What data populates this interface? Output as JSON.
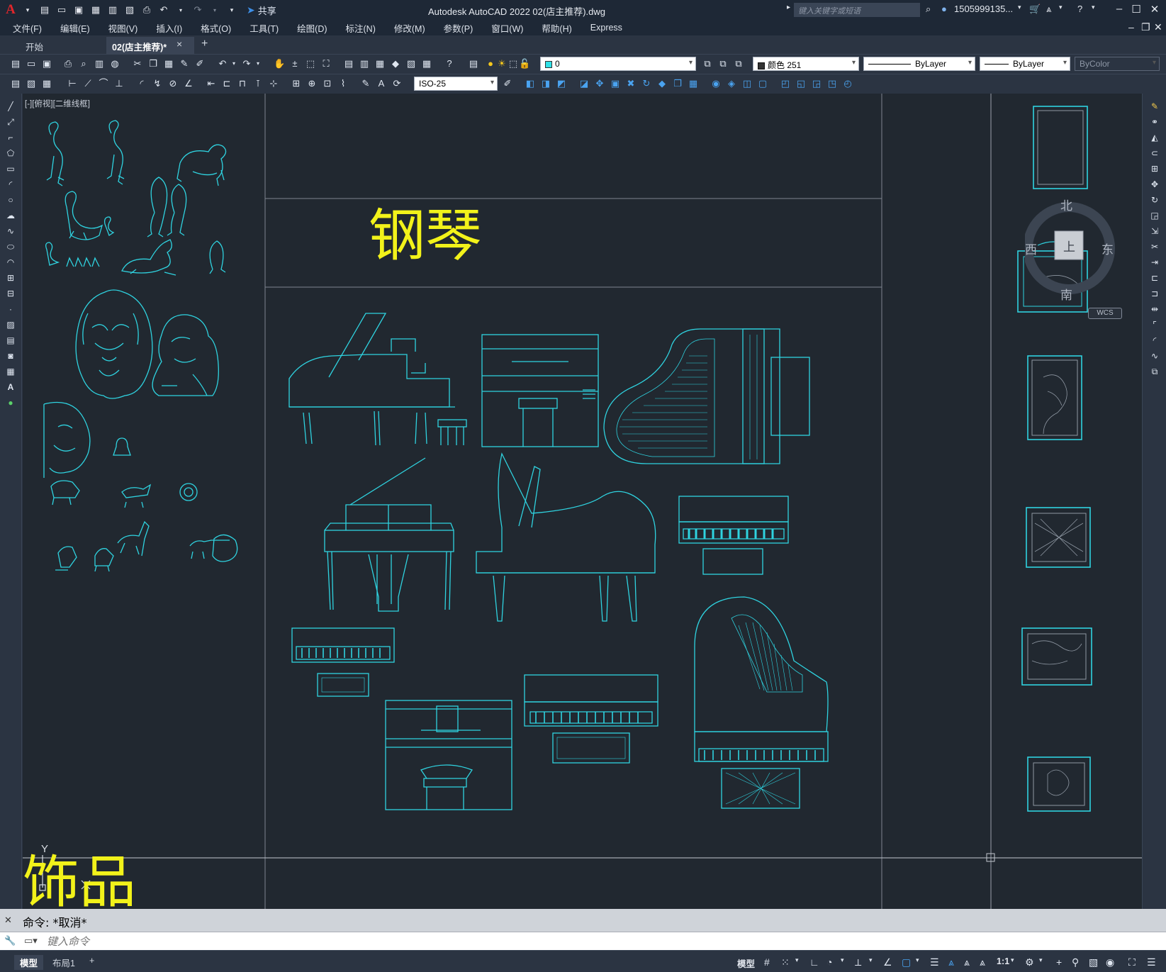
{
  "titlebar": {
    "title": "Autodesk AutoCAD 2022    02(店主推荐).dwg",
    "share_label": "共享",
    "search_placeholder": "键入关键字或短语",
    "user": "1505999135...",
    "colors": {
      "bg": "#1e2836",
      "logo": "#e0262b"
    }
  },
  "menu": [
    "文件(F)",
    "编辑(E)",
    "视图(V)",
    "插入(I)",
    "格式(O)",
    "工具(T)",
    "绘图(D)",
    "标注(N)",
    "修改(M)",
    "参数(P)",
    "窗口(W)",
    "帮助(H)",
    "Express"
  ],
  "tabs": {
    "start": "开始",
    "active": "02(店主推荐)*",
    "close": "×",
    "add": "+"
  },
  "properties": {
    "layer": "0",
    "color": "颜色 251",
    "linetype": "ByLayer",
    "lineweight": "ByLayer",
    "plotstyle": "ByColor",
    "dimstyle": "ISO-25"
  },
  "viewport": {
    "label": "[-][俯视][二维线框]",
    "heading": "钢琴",
    "bottom_heading": "饰品",
    "y_axis": "Y",
    "colors": {
      "background": "#212830",
      "linework": "#2fd3e0",
      "heading": "#f2f21a",
      "frame": "#8b929c"
    }
  },
  "viewcube": {
    "north": "北",
    "south": "南",
    "east": "东",
    "west": "西",
    "top": "上",
    "wcs": "WCS"
  },
  "command": {
    "history": "命令: *取消*",
    "placeholder": "键入命令"
  },
  "status": {
    "model_tab": "模型",
    "layout_tab": "布局1",
    "add": "+",
    "model_button": "模型",
    "scale": "1:1"
  }
}
